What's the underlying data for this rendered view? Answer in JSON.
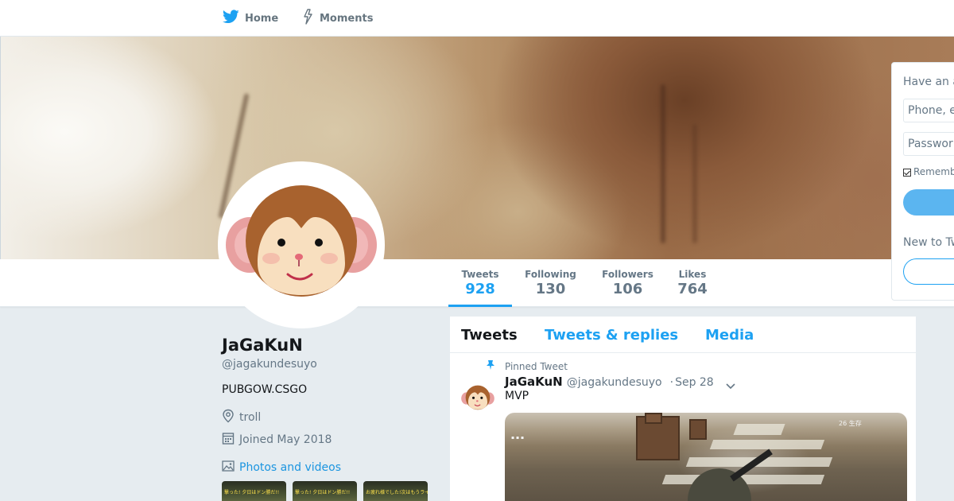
{
  "nav": {
    "home_label": "Home",
    "moments_label": "Moments"
  },
  "profile": {
    "name": "JaGaKuN",
    "handle": "@jagakundesuyo",
    "bio": "PUBGOW.CSGO",
    "location": "troll",
    "joined": "Joined May 2018",
    "photos_link": "Photos and videos"
  },
  "stats": [
    {
      "label": "Tweets",
      "value": "928",
      "active": true
    },
    {
      "label": "Following",
      "value": "130",
      "active": false
    },
    {
      "label": "Followers",
      "value": "106",
      "active": false
    },
    {
      "label": "Likes",
      "value": "764",
      "active": false
    }
  ],
  "timeline": {
    "tabs": [
      {
        "label": "Tweets",
        "current": true
      },
      {
        "label": "Tweets & replies",
        "current": false
      },
      {
        "label": "Media",
        "current": false
      }
    ],
    "pinned_label": "Pinned Tweet",
    "tweet": {
      "name": "JaGaKuN",
      "handle": "@jagakundesuyo",
      "separator": "·",
      "date": "Sep 28",
      "text": "MVP"
    }
  },
  "thumbnails": [
    {
      "caption": "撃った! 夕日はドン勝だ!!"
    },
    {
      "caption": "撃った! 夕日はドン勝だ!!"
    },
    {
      "caption": "お疲れ様でした!次はもうライツです"
    }
  ],
  "login": {
    "title": "Have an a",
    "phone_placeholder": "Phone, e",
    "password_placeholder": "Passwor",
    "remember": "Rememb",
    "new_to": "New to Tw"
  },
  "colors": {
    "accent": "#1da1f2",
    "link": "#1b95e0",
    "muted": "#657786",
    "background": "#e6ecf0"
  },
  "icons": {
    "home": "twitter-bird-icon",
    "moments": "lightning-icon",
    "location": "location-pin-icon",
    "joined": "calendar-icon",
    "photos": "image-icon",
    "pinned": "pin-icon",
    "caret": "chevron-down-icon"
  }
}
